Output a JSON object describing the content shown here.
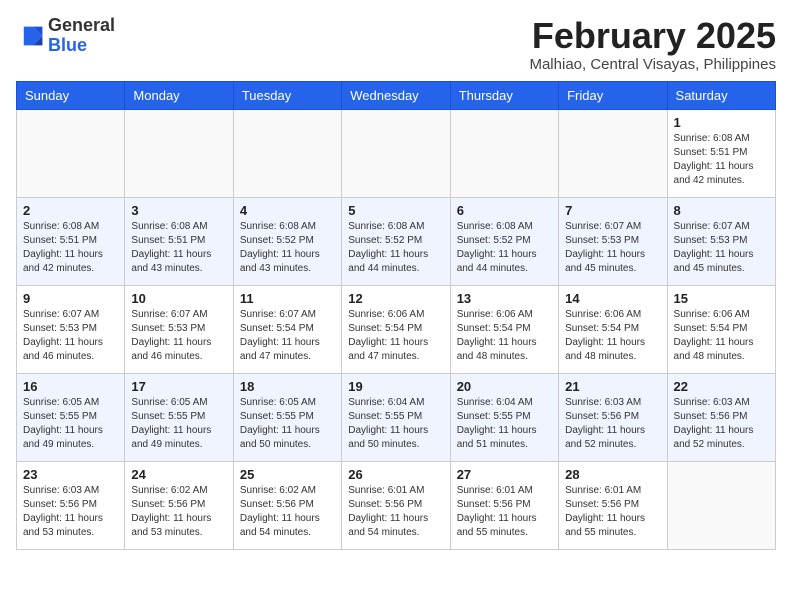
{
  "header": {
    "logo_general": "General",
    "logo_blue": "Blue",
    "month_title": "February 2025",
    "location": "Malhiao, Central Visayas, Philippines"
  },
  "weekdays": [
    "Sunday",
    "Monday",
    "Tuesday",
    "Wednesday",
    "Thursday",
    "Friday",
    "Saturday"
  ],
  "weeks": [
    [
      {
        "day": "",
        "info": ""
      },
      {
        "day": "",
        "info": ""
      },
      {
        "day": "",
        "info": ""
      },
      {
        "day": "",
        "info": ""
      },
      {
        "day": "",
        "info": ""
      },
      {
        "day": "",
        "info": ""
      },
      {
        "day": "1",
        "info": "Sunrise: 6:08 AM\nSunset: 5:51 PM\nDaylight: 11 hours\nand 42 minutes."
      }
    ],
    [
      {
        "day": "2",
        "info": "Sunrise: 6:08 AM\nSunset: 5:51 PM\nDaylight: 11 hours\nand 42 minutes."
      },
      {
        "day": "3",
        "info": "Sunrise: 6:08 AM\nSunset: 5:51 PM\nDaylight: 11 hours\nand 43 minutes."
      },
      {
        "day": "4",
        "info": "Sunrise: 6:08 AM\nSunset: 5:52 PM\nDaylight: 11 hours\nand 43 minutes."
      },
      {
        "day": "5",
        "info": "Sunrise: 6:08 AM\nSunset: 5:52 PM\nDaylight: 11 hours\nand 44 minutes."
      },
      {
        "day": "6",
        "info": "Sunrise: 6:08 AM\nSunset: 5:52 PM\nDaylight: 11 hours\nand 44 minutes."
      },
      {
        "day": "7",
        "info": "Sunrise: 6:07 AM\nSunset: 5:53 PM\nDaylight: 11 hours\nand 45 minutes."
      },
      {
        "day": "8",
        "info": "Sunrise: 6:07 AM\nSunset: 5:53 PM\nDaylight: 11 hours\nand 45 minutes."
      }
    ],
    [
      {
        "day": "9",
        "info": "Sunrise: 6:07 AM\nSunset: 5:53 PM\nDaylight: 11 hours\nand 46 minutes."
      },
      {
        "day": "10",
        "info": "Sunrise: 6:07 AM\nSunset: 5:53 PM\nDaylight: 11 hours\nand 46 minutes."
      },
      {
        "day": "11",
        "info": "Sunrise: 6:07 AM\nSunset: 5:54 PM\nDaylight: 11 hours\nand 47 minutes."
      },
      {
        "day": "12",
        "info": "Sunrise: 6:06 AM\nSunset: 5:54 PM\nDaylight: 11 hours\nand 47 minutes."
      },
      {
        "day": "13",
        "info": "Sunrise: 6:06 AM\nSunset: 5:54 PM\nDaylight: 11 hours\nand 48 minutes."
      },
      {
        "day": "14",
        "info": "Sunrise: 6:06 AM\nSunset: 5:54 PM\nDaylight: 11 hours\nand 48 minutes."
      },
      {
        "day": "15",
        "info": "Sunrise: 6:06 AM\nSunset: 5:54 PM\nDaylight: 11 hours\nand 48 minutes."
      }
    ],
    [
      {
        "day": "16",
        "info": "Sunrise: 6:05 AM\nSunset: 5:55 PM\nDaylight: 11 hours\nand 49 minutes."
      },
      {
        "day": "17",
        "info": "Sunrise: 6:05 AM\nSunset: 5:55 PM\nDaylight: 11 hours\nand 49 minutes."
      },
      {
        "day": "18",
        "info": "Sunrise: 6:05 AM\nSunset: 5:55 PM\nDaylight: 11 hours\nand 50 minutes."
      },
      {
        "day": "19",
        "info": "Sunrise: 6:04 AM\nSunset: 5:55 PM\nDaylight: 11 hours\nand 50 minutes."
      },
      {
        "day": "20",
        "info": "Sunrise: 6:04 AM\nSunset: 5:55 PM\nDaylight: 11 hours\nand 51 minutes."
      },
      {
        "day": "21",
        "info": "Sunrise: 6:03 AM\nSunset: 5:56 PM\nDaylight: 11 hours\nand 52 minutes."
      },
      {
        "day": "22",
        "info": "Sunrise: 6:03 AM\nSunset: 5:56 PM\nDaylight: 11 hours\nand 52 minutes."
      }
    ],
    [
      {
        "day": "23",
        "info": "Sunrise: 6:03 AM\nSunset: 5:56 PM\nDaylight: 11 hours\nand 53 minutes."
      },
      {
        "day": "24",
        "info": "Sunrise: 6:02 AM\nSunset: 5:56 PM\nDaylight: 11 hours\nand 53 minutes."
      },
      {
        "day": "25",
        "info": "Sunrise: 6:02 AM\nSunset: 5:56 PM\nDaylight: 11 hours\nand 54 minutes."
      },
      {
        "day": "26",
        "info": "Sunrise: 6:01 AM\nSunset: 5:56 PM\nDaylight: 11 hours\nand 54 minutes."
      },
      {
        "day": "27",
        "info": "Sunrise: 6:01 AM\nSunset: 5:56 PM\nDaylight: 11 hours\nand 55 minutes."
      },
      {
        "day": "28",
        "info": "Sunrise: 6:01 AM\nSunset: 5:56 PM\nDaylight: 11 hours\nand 55 minutes."
      },
      {
        "day": "",
        "info": ""
      }
    ]
  ]
}
